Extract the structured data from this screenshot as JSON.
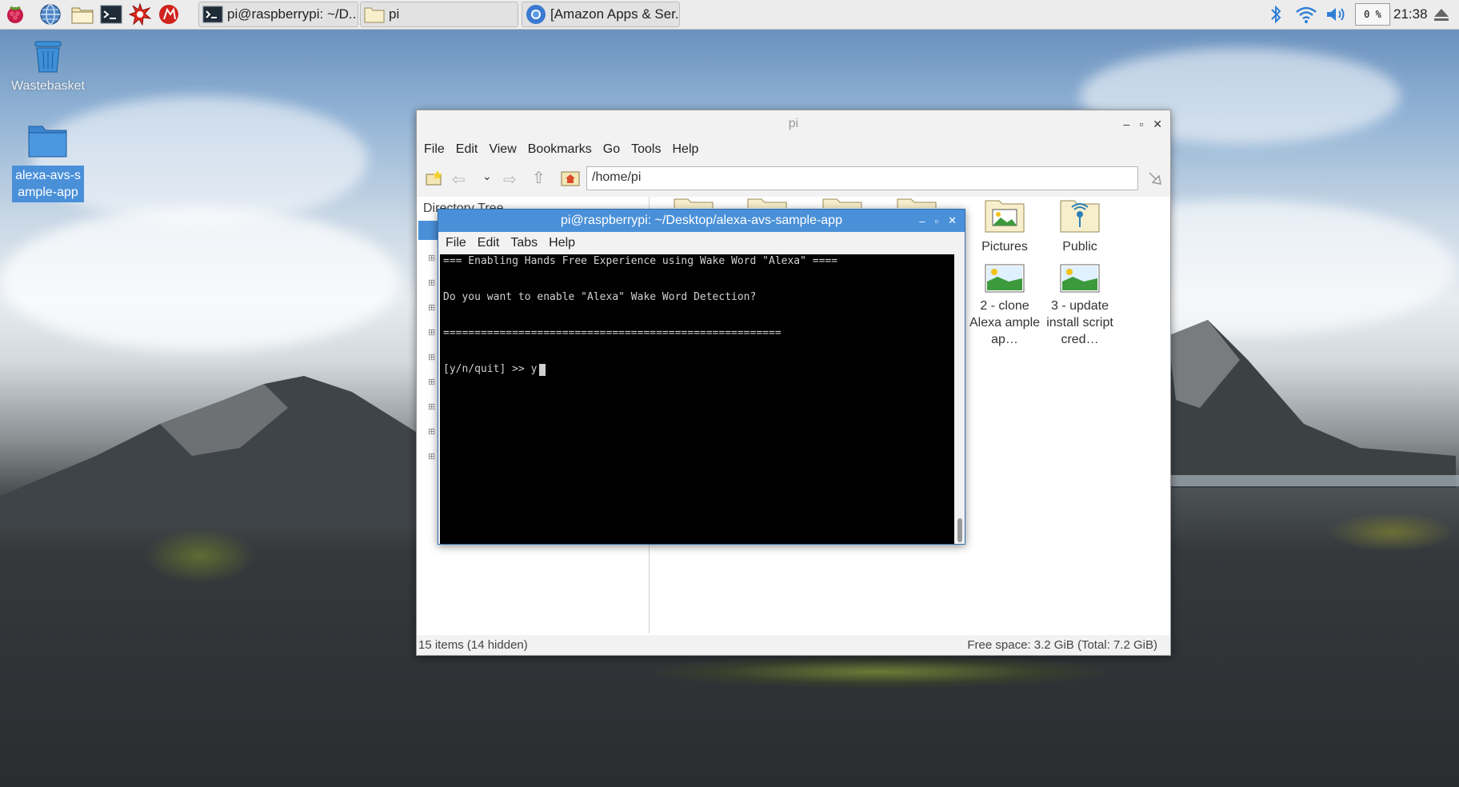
{
  "taskbar": {
    "launchers": [
      "raspberry-menu-icon",
      "globe-icon",
      "folder-icon",
      "terminal-icon",
      "burst-icon",
      "wolfram-icon"
    ],
    "tasks": [
      {
        "label": "pi@raspberrypi: ~/D...",
        "icon": "terminal-icon"
      },
      {
        "label": "pi",
        "icon": "folder-icon"
      },
      {
        "label": "[Amazon Apps & Ser...",
        "icon": "chromium-icon"
      }
    ],
    "cpu_usage": "0 %",
    "clock": "21:38"
  },
  "desktop": {
    "wastebasket_label": "Wastebasket",
    "folder_label": "alexa-avs-sample-app"
  },
  "file_manager": {
    "title": "pi",
    "menu": [
      "File",
      "Edit",
      "View",
      "Bookmarks",
      "Go",
      "Tools",
      "Help"
    ],
    "path": "/home/pi",
    "sidebar_title": "Directory Tree",
    "icons": [
      {
        "label": "Pictures",
        "type": "folder-pictures"
      },
      {
        "label": "Public",
        "type": "folder-public"
      },
      {
        "label": "2 - clone Alexa ample ap…",
        "type": "image"
      },
      {
        "label": "3 - update install script cred…",
        "type": "image"
      }
    ],
    "status_left": "15 items (14 hidden)",
    "status_right": "Free space: 3.2 GiB (Total: 7.2 GiB)"
  },
  "terminal": {
    "title": "pi@raspberrypi: ~/Desktop/alexa-avs-sample-app",
    "menu": [
      "File",
      "Edit",
      "Tabs",
      "Help"
    ],
    "lines": [
      "=== Enabling Hands Free Experience using Wake Word \"Alexa\" ====",
      "Do you want to enable \"Alexa\" Wake Word Detection?",
      "======================================================",
      "[y/n/quit] >> y"
    ]
  },
  "colors": {
    "taskbar_bg": "#ececec",
    "terminal_title_bg": "#4a90d9",
    "terminal_bg": "#000000",
    "selection": "#4a90d9"
  }
}
